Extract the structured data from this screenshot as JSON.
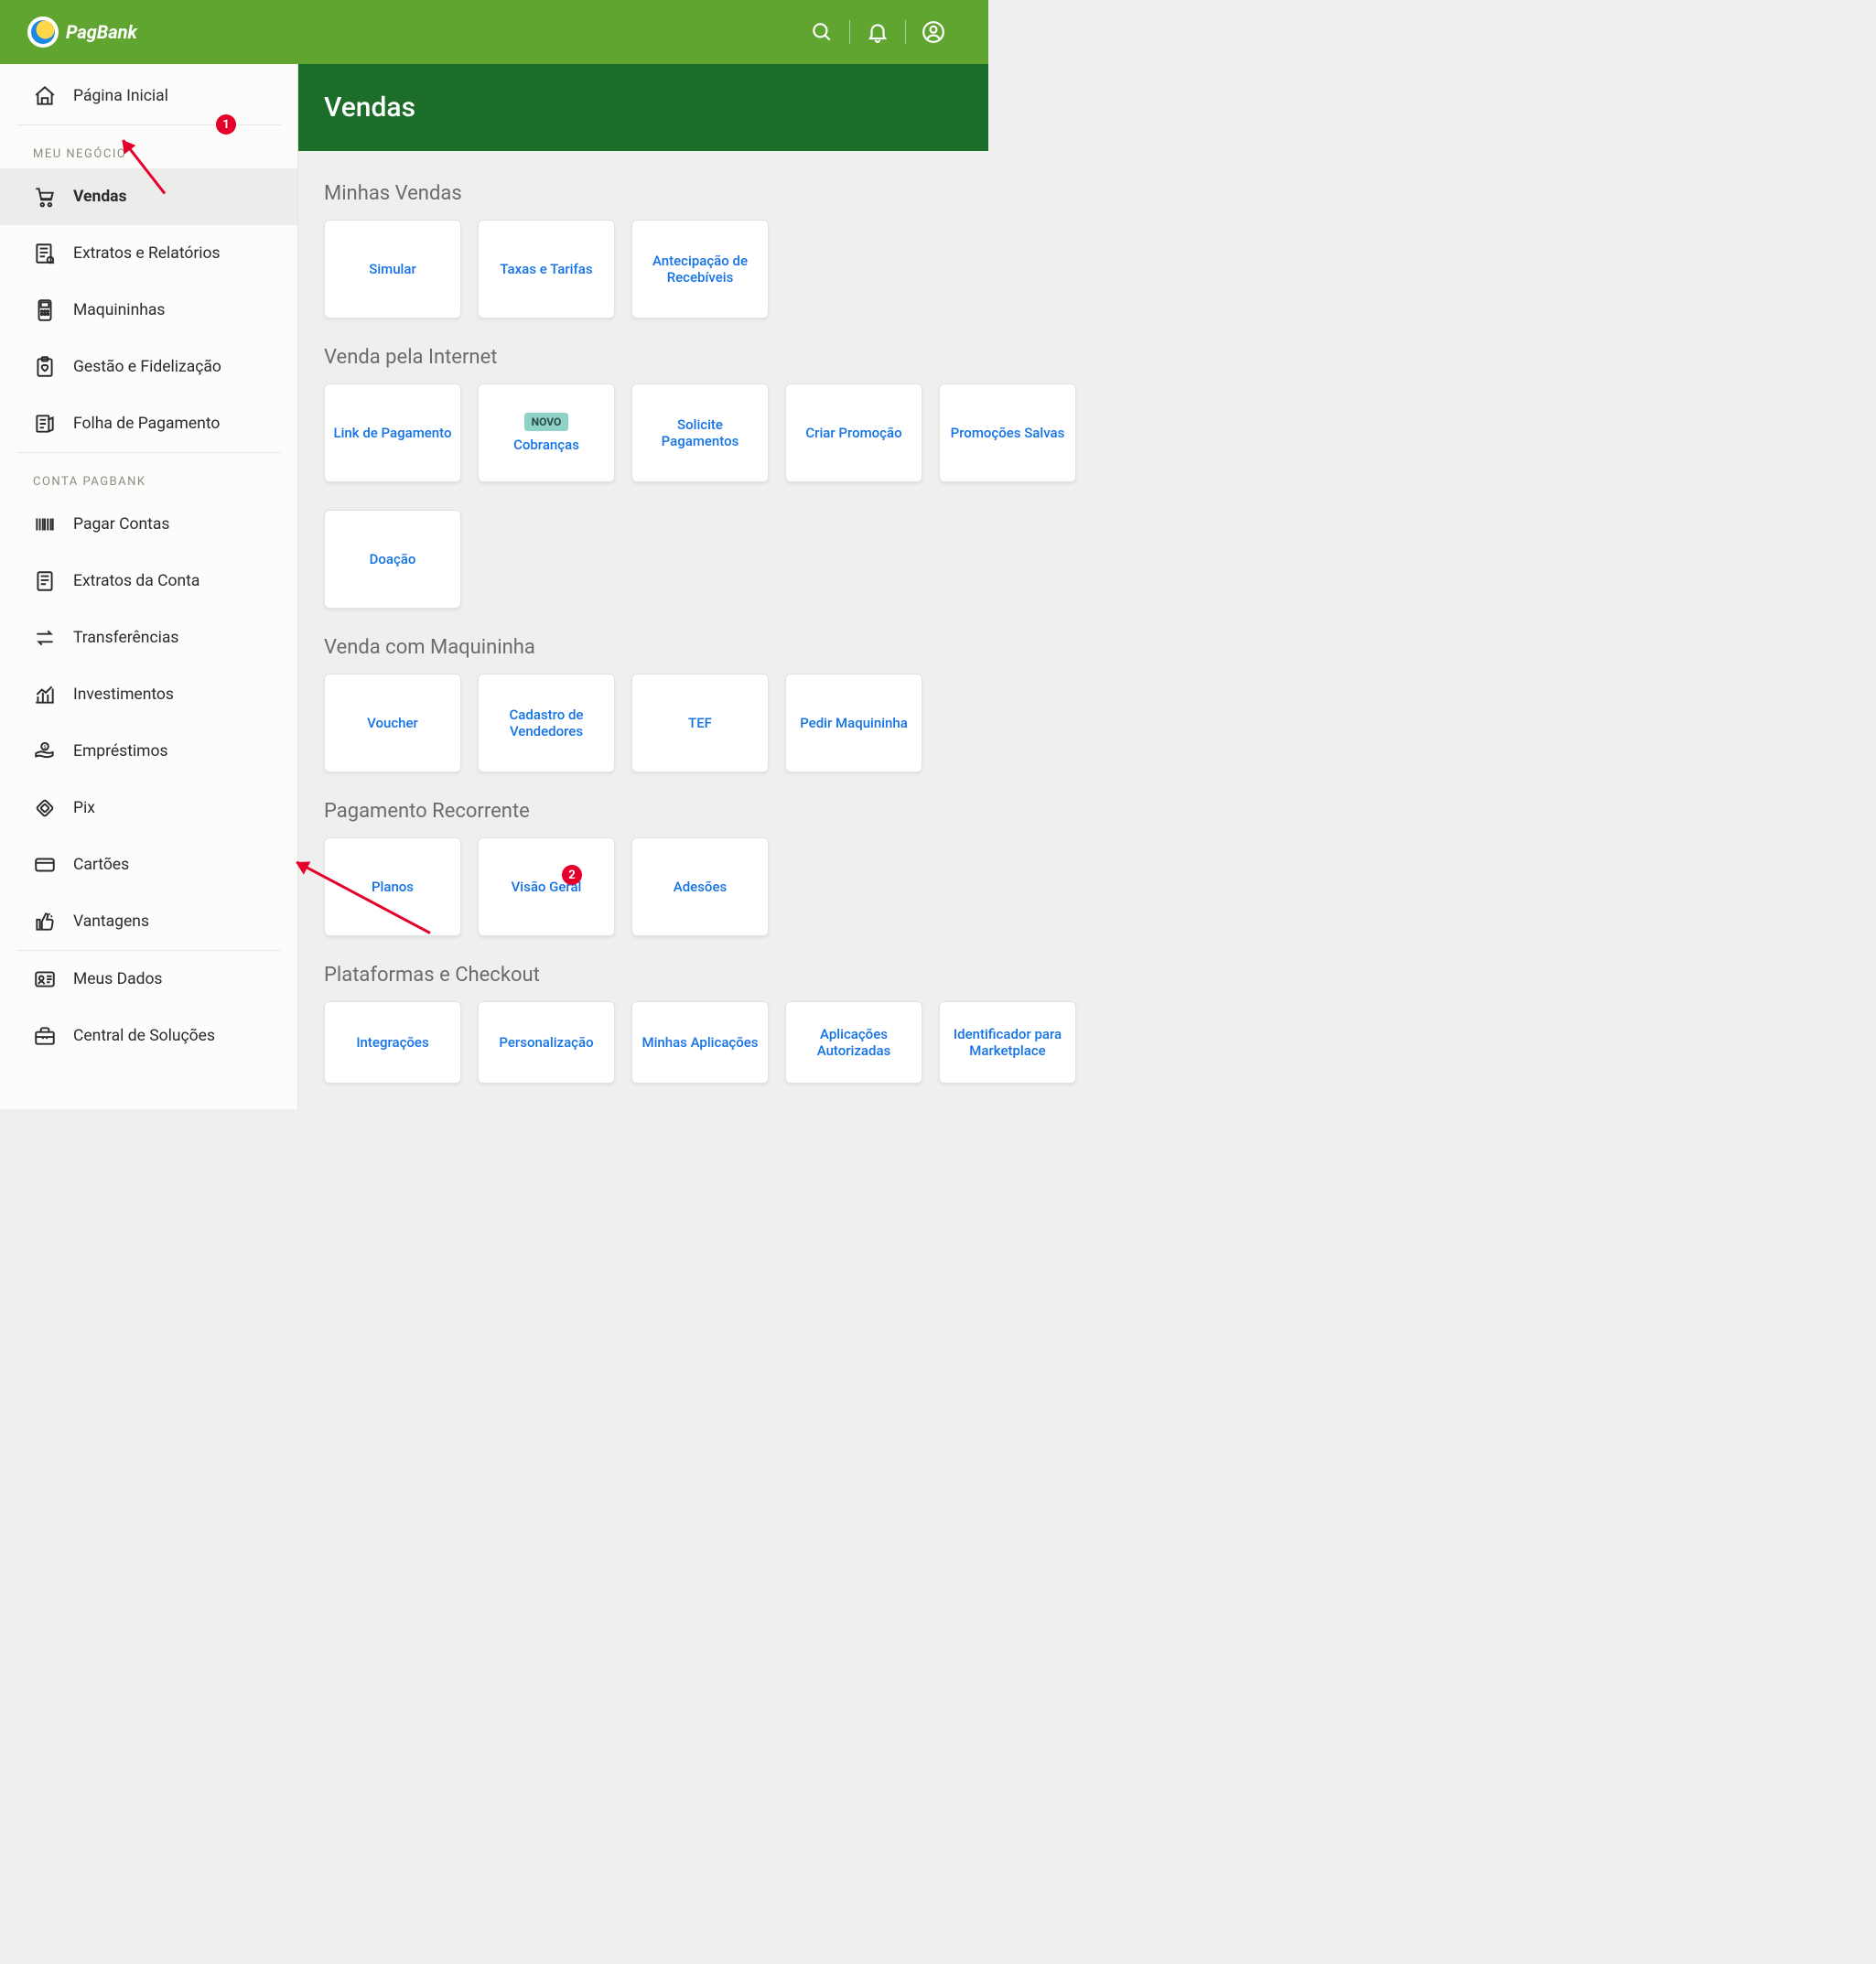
{
  "brand": {
    "name": "PagBank"
  },
  "header_icons": [
    "search",
    "notifications",
    "account"
  ],
  "sidebar": {
    "top": {
      "label": "Página Inicial"
    },
    "section1_label": "MEU NEGÓCIO",
    "items1": [
      {
        "label": "Vendas",
        "active": true
      },
      {
        "label": "Extratos e Relatórios"
      },
      {
        "label": "Maquininhas"
      },
      {
        "label": "Gestão e Fidelização"
      },
      {
        "label": "Folha de Pagamento"
      }
    ],
    "section2_label": "CONTA PAGBANK",
    "items2": [
      {
        "label": "Pagar Contas"
      },
      {
        "label": "Extratos da Conta"
      },
      {
        "label": "Transferências"
      },
      {
        "label": "Investimentos"
      },
      {
        "label": "Empréstimos"
      },
      {
        "label": "Pix"
      },
      {
        "label": "Cartões"
      },
      {
        "label": "Vantagens"
      }
    ],
    "items3": [
      {
        "label": "Meus Dados"
      },
      {
        "label": "Central de Soluções"
      }
    ]
  },
  "page": {
    "title": "Vendas"
  },
  "sections": {
    "s1": {
      "title": "Minhas Vendas",
      "cards": [
        "Simular",
        "Taxas e Tarifas",
        "Antecipação de Recebíveis"
      ]
    },
    "s2": {
      "title": "Venda pela Internet",
      "cards_row1": [
        {
          "label": "Link de Pagamento"
        },
        {
          "label": "Cobranças",
          "badge": "NOVO"
        },
        {
          "label": "Solicite Pagamentos"
        },
        {
          "label": "Criar Promoção"
        },
        {
          "label": "Promoções Salvas"
        }
      ],
      "cards_row2": [
        {
          "label": "Doação"
        }
      ]
    },
    "s3": {
      "title": "Venda com Maquininha",
      "cards": [
        "Voucher",
        "Cadastro de Vendedores",
        "TEF",
        "Pedir Maquininha"
      ]
    },
    "s4": {
      "title": "Pagamento Recorrente",
      "cards": [
        "Planos",
        "Visão Geral",
        "Adesões"
      ]
    },
    "s5": {
      "title": "Plataformas e Checkout",
      "cards": [
        "Integrações",
        "Personalização",
        "Minhas Aplicações",
        "Aplicações Autorizadas",
        "Identificador para Marketplace"
      ]
    }
  },
  "annotations": {
    "a1": "1",
    "a2": "2"
  }
}
